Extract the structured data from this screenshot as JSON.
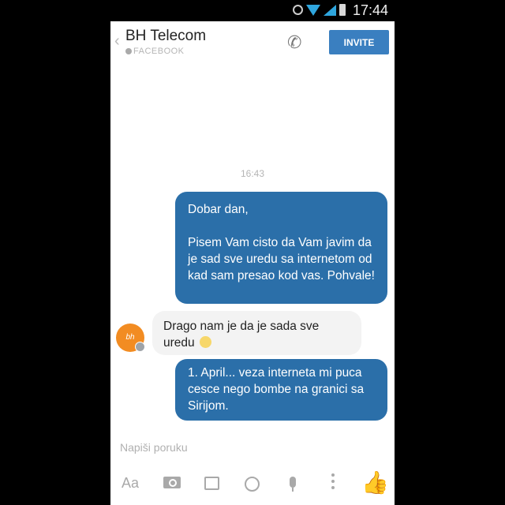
{
  "status_bar": {
    "time": "17:44"
  },
  "header": {
    "back_glyph": "‹",
    "title": "BH Telecom",
    "subtitle": "FACEBOOK",
    "invite_label": "INVITE"
  },
  "conversation": {
    "timestamp": "16:43",
    "messages": [
      {
        "from": "me",
        "text": "Dobar dan,\n\nPisem Vam cisto da Vam javim da je sad sve uredu sa internetom od kad sam presao kod vas. Pohvale!"
      },
      {
        "from": "page",
        "text": "Drago nam je da je sada sve uredu"
      },
      {
        "from": "me",
        "text": "1. April... veza interneta mi puca cesce nego bombe na granici sa Sirijom."
      }
    ],
    "avatar_text": "bh"
  },
  "composer": {
    "placeholder": "Napiši poruku",
    "aa_label": "Aa"
  },
  "icons": {
    "status": [
      "sync-icon",
      "wifi-icon",
      "signal-icon",
      "battery-icon"
    ],
    "toolbar": [
      "camera-icon",
      "image-icon",
      "emoji-icon",
      "microphone-icon",
      "more-icon",
      "like-icon"
    ]
  },
  "colors": {
    "accent": "#3a7fc0",
    "outgoing_bubble": "#2b6fa9",
    "incoming_bubble": "#f3f3f3",
    "avatar": "#f28c22"
  }
}
